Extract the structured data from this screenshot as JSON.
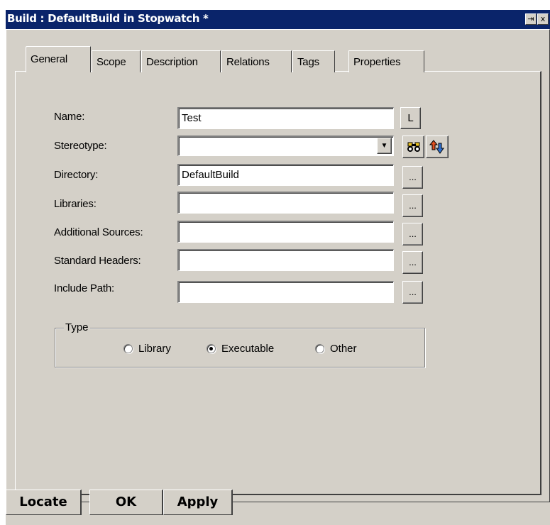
{
  "window": {
    "title": "Build : DefaultBuild in Stopwatch *",
    "control_button_1": "⇥",
    "control_button_2": "x"
  },
  "tabs": [
    {
      "label": "General",
      "active": true
    },
    {
      "label": "Scope",
      "active": false
    },
    {
      "label": "Description",
      "active": false
    },
    {
      "label": "Relations",
      "active": false
    },
    {
      "label": "Tags",
      "active": false
    },
    {
      "label": "Properties",
      "active": false
    }
  ],
  "form": {
    "name": {
      "label": "Name:",
      "value": "Test",
      "button": "L"
    },
    "stereotype": {
      "label": "Stereotype:",
      "value": "",
      "dropdown_icon": "▼",
      "locate_icon": "binoculars-icon",
      "sort_icon": "up-down-arrows-icon"
    },
    "directory": {
      "label": "Directory:",
      "value": "DefaultBuild",
      "button": "..."
    },
    "libraries": {
      "label": "Libraries:",
      "value": "",
      "button": "..."
    },
    "additional_sources": {
      "label": "Additional Sources:",
      "value": "",
      "button": "..."
    },
    "standard_headers": {
      "label": "Standard Headers:",
      "value": "",
      "button": "..."
    },
    "include_path": {
      "label": "Include Path:",
      "value": "",
      "button": "..."
    }
  },
  "type_group": {
    "title": "Type",
    "options": [
      {
        "label": "Library",
        "selected": false
      },
      {
        "label": "Executable",
        "selected": true
      },
      {
        "label": "Other",
        "selected": false
      }
    ]
  },
  "actions": {
    "locate": "Locate",
    "ok": "OK",
    "apply": "Apply"
  },
  "colors": {
    "title_bar": "#0a246a",
    "dialog_face": "#d4d0c8"
  }
}
